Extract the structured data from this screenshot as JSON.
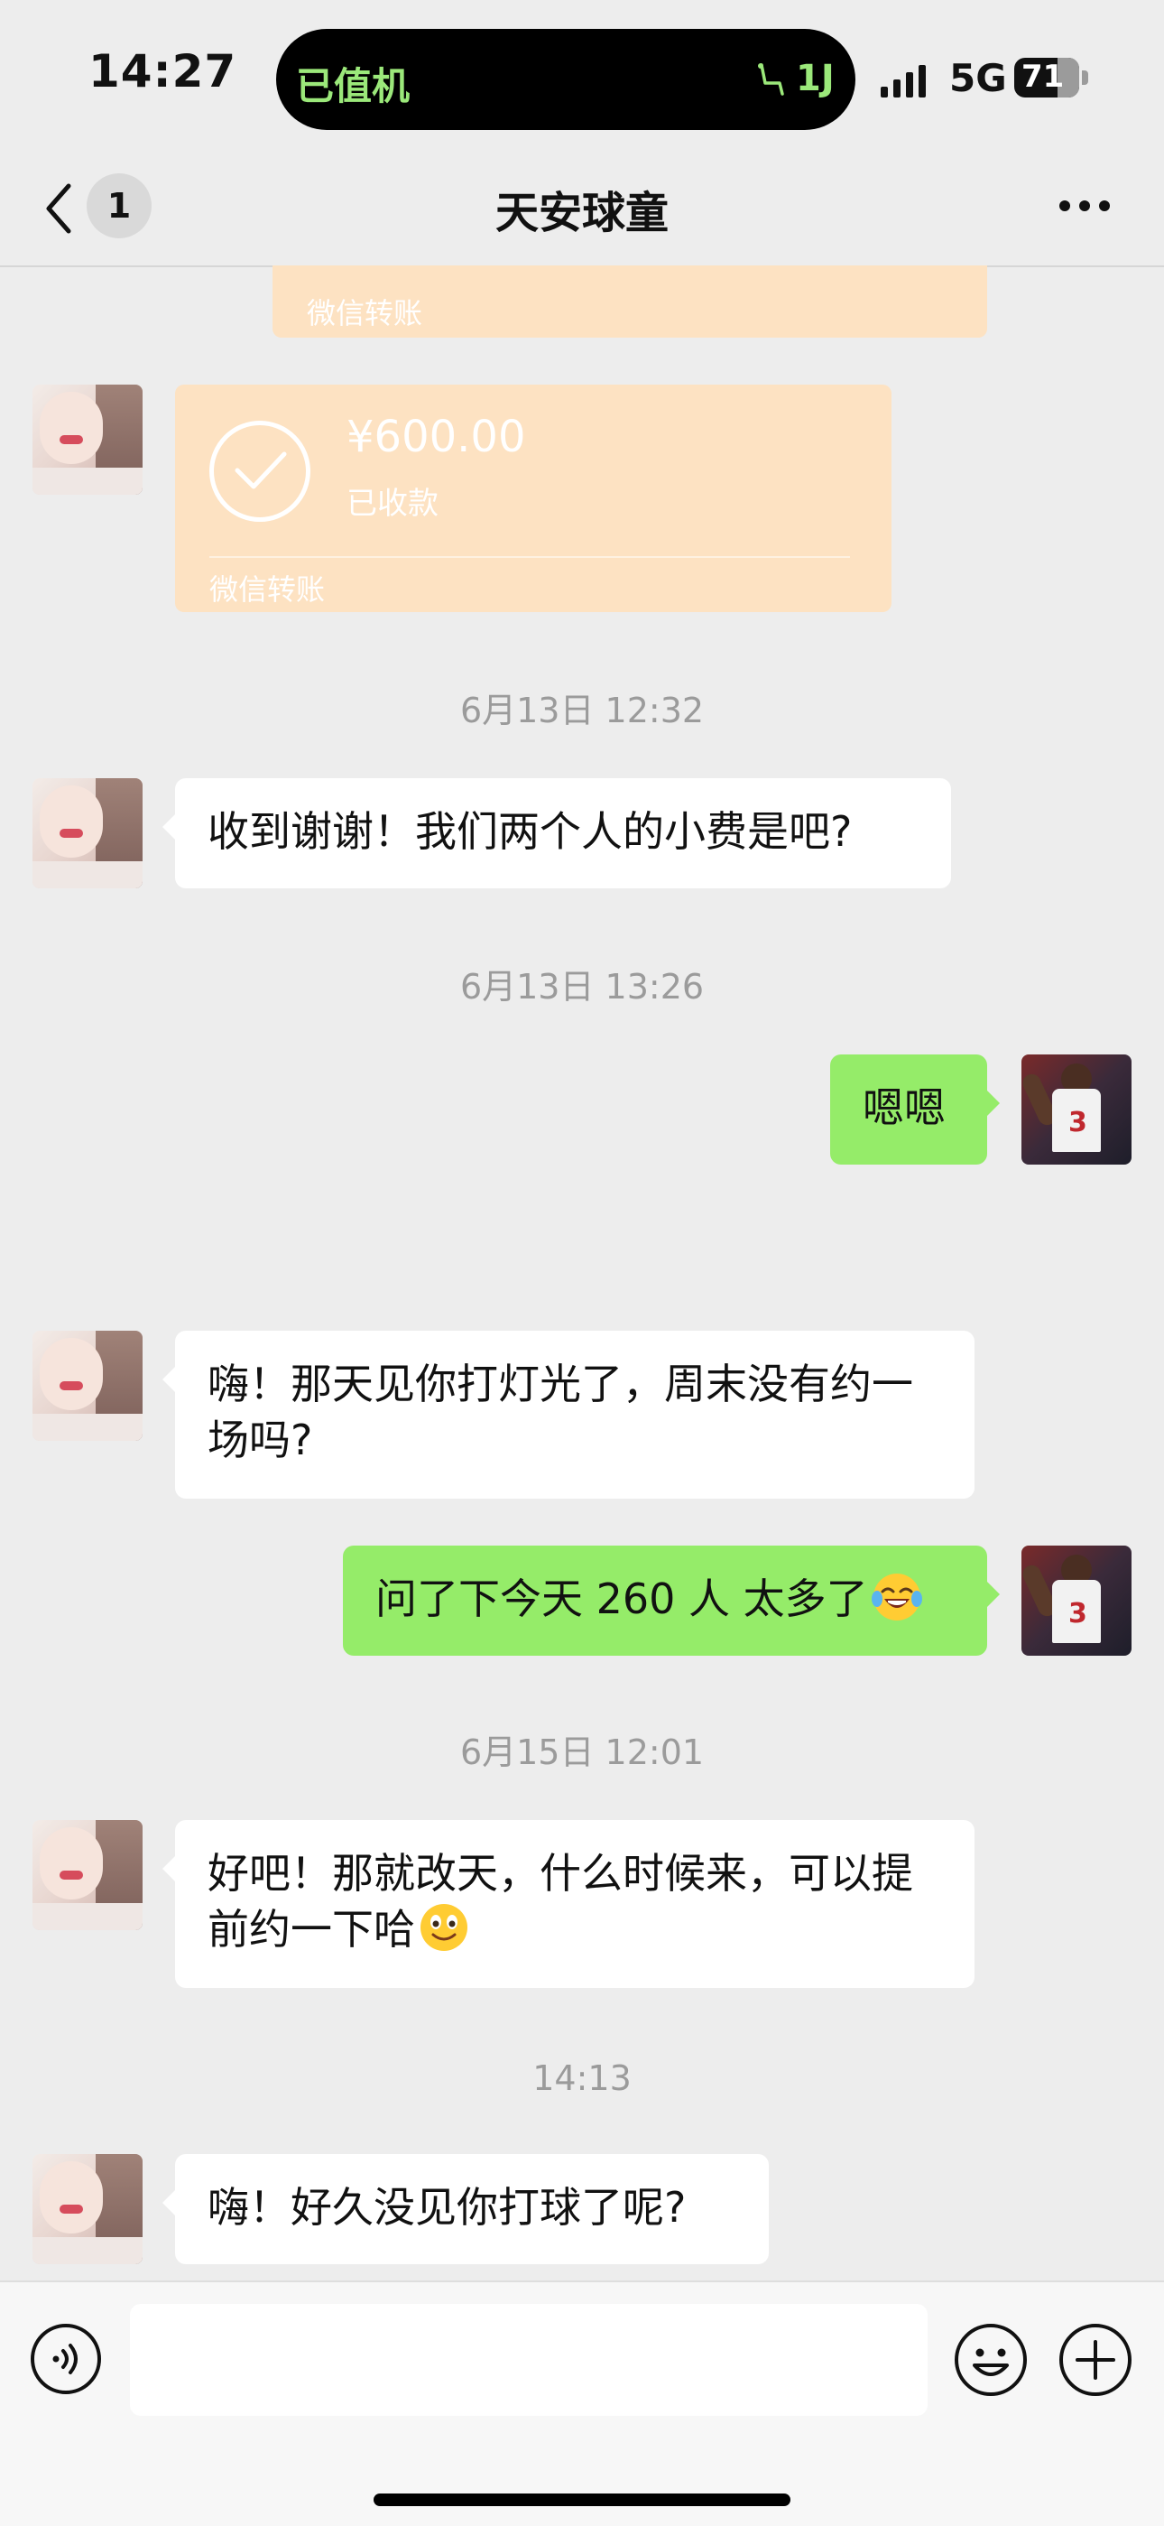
{
  "status_bar": {
    "time": "14:27",
    "island_status": "已值机",
    "island_code": "1J",
    "network": "5G",
    "battery": "71",
    "island_accent": "#9be87a"
  },
  "nav": {
    "unread_count": "1",
    "title": "天安球童",
    "icons": [
      "chevron-left-icon",
      "more-icon"
    ]
  },
  "transfers": {
    "partial_caption": "微信转账",
    "amount": "¥600.00",
    "status": "已收款",
    "caption": "微信转账",
    "card_color": "#fde2c2"
  },
  "messages": [
    {
      "type": "timestamp",
      "text": "6月13日 12:32"
    },
    {
      "type": "incoming",
      "text": "收到谢谢！我们两个人的小费是吧?"
    },
    {
      "type": "timestamp",
      "text": "6月13日 13:26"
    },
    {
      "type": "outgoing",
      "text": "嗯嗯"
    },
    {
      "type": "incoming",
      "text": "嗨！那天见你打灯光了，周末没有约一场吗?"
    },
    {
      "type": "outgoing",
      "text": "问了下今天 260 人 太多了",
      "emoji": "laughing-tears-emoji"
    },
    {
      "type": "timestamp",
      "text": "6月15日 12:01"
    },
    {
      "type": "incoming",
      "text": "好吧！那就改天，什么时候来，可以提前约一下哈",
      "emoji": "smile-emoji"
    },
    {
      "type": "timestamp",
      "text": "14:13"
    },
    {
      "type": "incoming",
      "text": "嗨！好久没见你打球了呢?"
    }
  ],
  "colors": {
    "background": "#ededed",
    "outgoing_bubble": "#95ec69",
    "incoming_bubble": "#ffffff"
  },
  "input_bar": {
    "icons": [
      "voice-icon",
      "emoji-icon",
      "plus-icon"
    ]
  }
}
